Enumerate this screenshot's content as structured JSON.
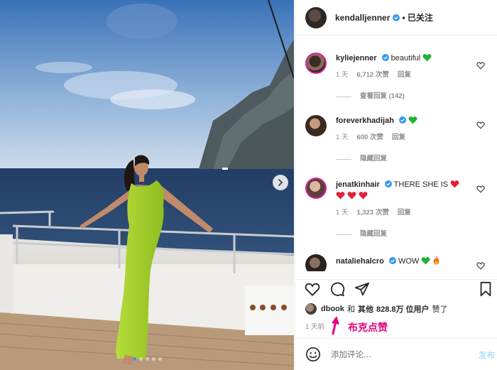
{
  "post": {
    "author": "kendalljenner",
    "follow_state": "• 已关注",
    "photo_alt": "",
    "carousel_total": 5,
    "carousel_active_index": 0
  },
  "comments": [
    {
      "username": "kyliejenner",
      "text": "beautiful",
      "emoji": [
        "green-heart"
      ],
      "verified": true,
      "age": "1 天",
      "likes": "6,712 次赞",
      "reply_label": "回复",
      "replies_toggle": "查看回复 (142)"
    },
    {
      "username": "foreverkhadijah",
      "text": "",
      "emoji": [
        "green-heart"
      ],
      "verified": true,
      "age": "1 天",
      "likes": "600 次赞",
      "reply_label": "回复",
      "replies_toggle": "隐藏回复"
    },
    {
      "username": "jenatkinhair",
      "text": "THERE SHE IS",
      "emoji": [
        "red-heart",
        "red-heart",
        "red-heart",
        "red-heart"
      ],
      "verified": true,
      "age": "1 天",
      "likes": "1,323 次赞",
      "reply_label": "回复",
      "replies_toggle": "隐藏回复"
    },
    {
      "username": "nataliehalcro",
      "text": "WOW",
      "emoji": [
        "green-heart",
        "fire"
      ],
      "verified": true
    }
  ],
  "likes_summary": {
    "user": "dbook",
    "and": "和",
    "others": "其他",
    "count": "828.8万",
    "suffix": "位用户",
    "liked": "赞了"
  },
  "post_age": "1 天前",
  "annotation": "布克点赞",
  "add_comment": {
    "placeholder": "添加评论...",
    "post_label": "发布"
  },
  "colors": {
    "verified_blue": "#3897f0",
    "annotation_pink": "#e5007e",
    "green_heart": "#21b233",
    "red_heart": "#e0223a",
    "dress_green": "#a8d12a"
  }
}
